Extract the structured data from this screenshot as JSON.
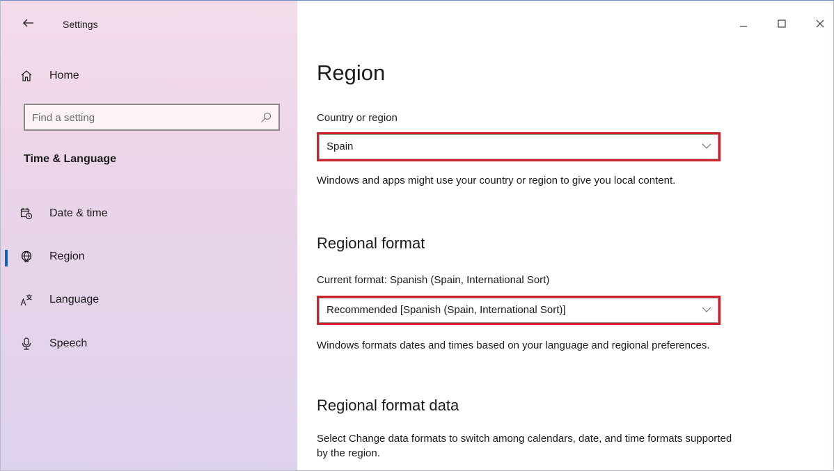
{
  "app": {
    "title": "Settings"
  },
  "window_controls": {
    "minimize_icon": "minimize-icon",
    "maximize_icon": "maximize-icon",
    "close_icon": "close-icon"
  },
  "sidebar": {
    "home_label": "Home",
    "search_placeholder": "Find a setting",
    "section_title": "Time & Language",
    "items": [
      {
        "label": "Date & time",
        "icon": "calendar-clock-icon",
        "selected": false
      },
      {
        "label": "Region",
        "icon": "globe-icon",
        "selected": true
      },
      {
        "label": "Language",
        "icon": "language-icon",
        "selected": false
      },
      {
        "label": "Speech",
        "icon": "microphone-icon",
        "selected": false
      }
    ]
  },
  "main": {
    "page_title": "Region",
    "country": {
      "label": "Country or region",
      "value": "Spain",
      "description": "Windows and apps might use your country or region to give you local content."
    },
    "regional_format": {
      "heading": "Regional format",
      "current_label": "Current format: Spanish (Spain, International Sort)",
      "value": "Recommended [Spanish (Spain, International Sort)]",
      "description": "Windows formats dates and times based on your language and regional preferences."
    },
    "regional_format_data": {
      "heading": "Regional format data",
      "description": "Select Change data formats to switch among calendars, date, and time formats supported by the region."
    }
  },
  "colors": {
    "accent": "#0a64c8",
    "highlight_box": "#d0202c",
    "sidebar_top": "#f3dcea",
    "sidebar_bottom": "#ddd2ec"
  }
}
